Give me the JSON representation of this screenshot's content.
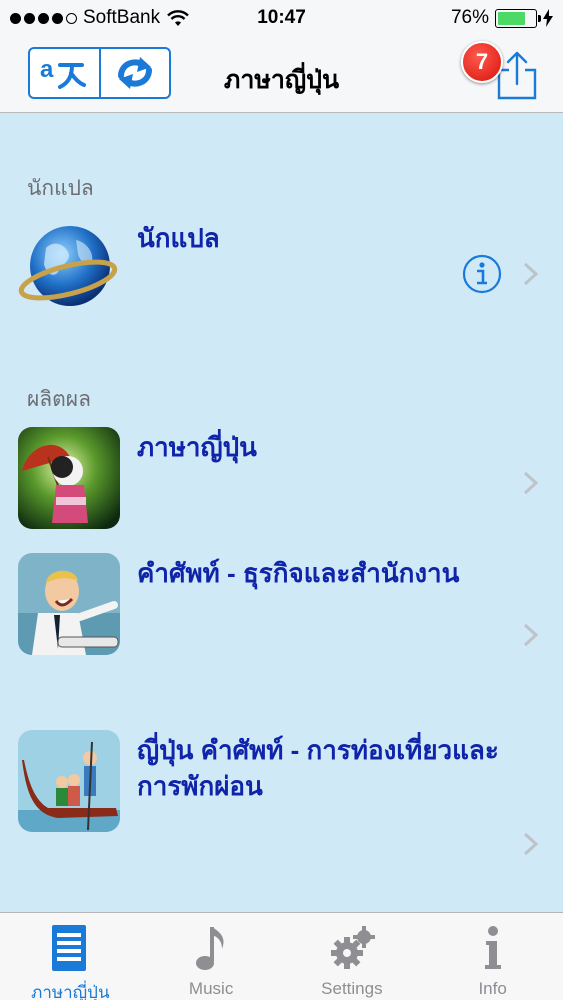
{
  "status_bar": {
    "carrier": "SoftBank",
    "time": "10:47",
    "battery_percent": "76%",
    "battery_level": 0.76,
    "signal_bars": 4
  },
  "nav": {
    "title": "ภาษาญี่ปุ่น",
    "notification_count": "7",
    "translate_icon": "translate-icon",
    "refresh_icon": "refresh-icon",
    "share_icon": "share-icon"
  },
  "sections": [
    {
      "header": "นักแปล",
      "items": [
        {
          "title": "นักแปล",
          "icon": "globe-icon",
          "has_info": true
        }
      ]
    },
    {
      "header": "ผลิตผล",
      "items": [
        {
          "title": "ภาษาญี่ปุ่น",
          "icon": "japanese-doll-icon"
        },
        {
          "title": "คำศัพท์ - ธุรกิจและสำนักงาน",
          "icon": "businessman-icon"
        },
        {
          "title": "ญี่ปุ่น คำศัพท์ - การท่องเที่ยวและการพักผ่อน",
          "icon": "gondola-icon"
        }
      ]
    }
  ],
  "tab_bar": {
    "tabs": [
      {
        "label": "ภาษาญี่ปุ่น",
        "icon": "list-icon",
        "active": true
      },
      {
        "label": "Music",
        "icon": "music-note-icon",
        "active": false
      },
      {
        "label": "Settings",
        "icon": "gear-icon",
        "active": false
      },
      {
        "label": "Info",
        "icon": "info-icon",
        "active": false
      }
    ]
  },
  "colors": {
    "accent": "#1a7ad8",
    "item_title": "#0f24a9",
    "background": "#cfe9f7",
    "badge": "#d8120c"
  }
}
